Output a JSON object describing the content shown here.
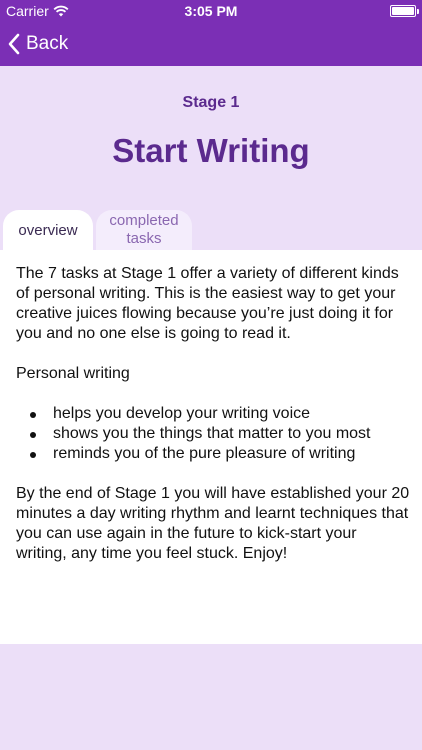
{
  "status_bar": {
    "carrier": "Carrier",
    "time": "3:05 PM"
  },
  "nav": {
    "back_label": "Back"
  },
  "header": {
    "stage": "Stage 1",
    "title": "Start Writing"
  },
  "tabs": [
    {
      "label": "overview",
      "selected": true
    },
    {
      "label": "completed tasks",
      "selected": false
    }
  ],
  "content": {
    "intro": "The 7 tasks at Stage 1 offer a variety of different kinds of personal writing. This is the easiest way to get your creative juices flowing because you’re just doing it for you and no one else is going to read it.",
    "subheading": "Personal writing",
    "bullets": [
      "helps you develop your writing voice",
      "shows you the things that matter to you most",
      "reminds you of the pure pleasure of writing"
    ],
    "closing": "By the end of Stage 1 you will have established your 20 minutes a day writing rhythm and learnt techniques that you can use again in the future to kick-start your writing, any time you feel stuck. Enjoy!"
  },
  "colors": {
    "nav_bar": "#7b2fb5",
    "background": "#ecdff8",
    "title": "#5b2a8e"
  }
}
